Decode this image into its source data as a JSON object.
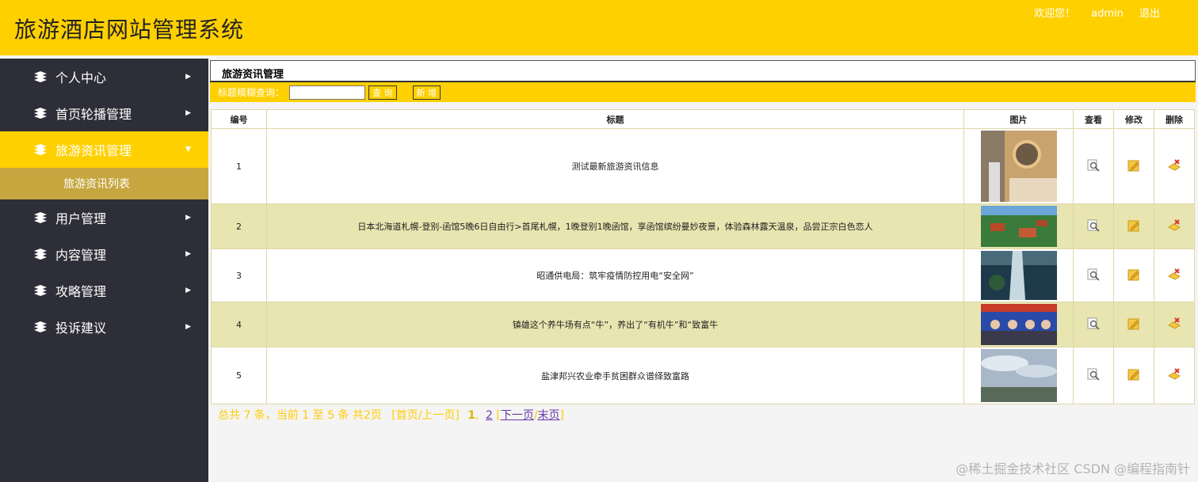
{
  "app": {
    "title": "旅游酒店网站管理系统"
  },
  "topbar": {
    "welcome": "欢迎您！",
    "user": "admin",
    "logout": "退出"
  },
  "sidebar": {
    "items": [
      {
        "label": "个人中心"
      },
      {
        "label": "首页轮播管理"
      },
      {
        "label": "旅游资讯管理",
        "active": true
      },
      {
        "label": "用户管理"
      },
      {
        "label": "内容管理"
      },
      {
        "label": "攻略管理"
      },
      {
        "label": "投诉建议"
      }
    ],
    "subitem": "旅游资讯列表"
  },
  "page": {
    "title": "旅游资讯管理"
  },
  "search": {
    "label": "标题模糊查询：",
    "value": "",
    "query_btn": "查 询",
    "add_btn": "新 增"
  },
  "table": {
    "headers": [
      "编号",
      "标题",
      "图片",
      "查看",
      "修改",
      "删除"
    ],
    "rows": [
      {
        "id": "1",
        "title": "测试最新旅游资讯信息",
        "thumb": "bathroom"
      },
      {
        "id": "2",
        "title": "日本北海道札幌-登别-函馆5晚6日自由行>首尾札幌，1晚登别1晚函馆，享函馆缤纷曼妙夜景，体验森林露天温泉，品尝正宗白色恋人",
        "thumb": "village"
      },
      {
        "id": "3",
        "title": "昭通供电局：筑牢疫情防控用电“安全网”",
        "thumb": "waterfall"
      },
      {
        "id": "4",
        "title": "镇雄这个养牛场有点“牛”，养出了“有机牛”和“致富牛",
        "thumb": "people"
      },
      {
        "id": "5",
        "title": "盐津邦兴农业牵手贫困群众谱绎致富路",
        "thumb": "sky"
      }
    ]
  },
  "pager": {
    "summary": "总共 7 条，当前 1 至 5 条 共2页",
    "first_prev": "[首页/上一页]",
    "page1": "1",
    "comma": ",",
    "page2": "2",
    "next": "下一页",
    "slash": "/",
    "last": "末页",
    "open_bracket": "[",
    "close_bracket": "]"
  },
  "watermark": "@稀土掘金技术社区 CSDN @编程指南针",
  "colors": {
    "accent": "#ffd000",
    "sidebar": "#2e2e38",
    "sub": "#c6a63f",
    "alt_row": "#e8e5b0"
  }
}
